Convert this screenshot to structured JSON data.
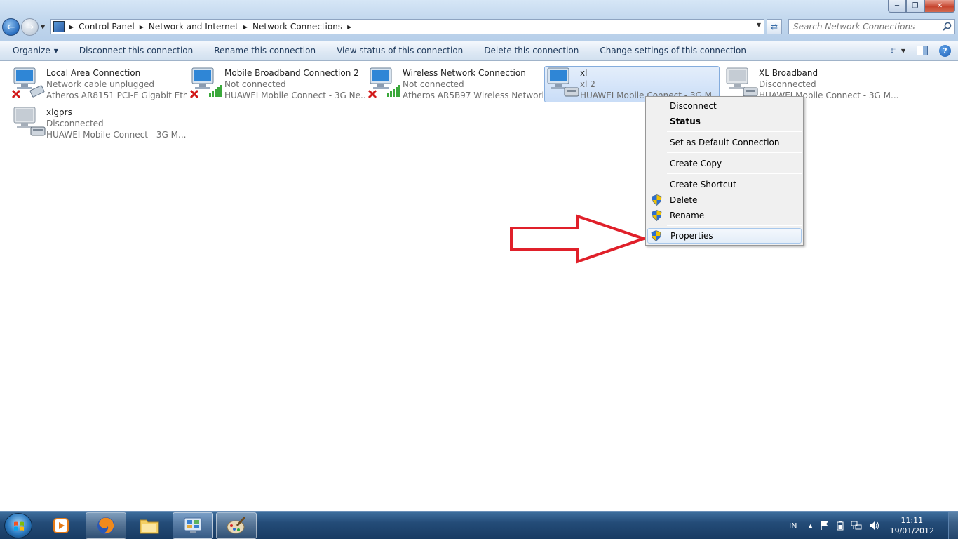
{
  "address": {
    "crumbs": [
      "Control Panel",
      "Network and Internet",
      "Network Connections"
    ]
  },
  "search": {
    "placeholder": "Search Network Connections"
  },
  "toolbar": {
    "organize": "Organize",
    "disconnect": "Disconnect this connection",
    "rename": "Rename this connection",
    "view_status": "View status of this connection",
    "delete": "Delete this connection",
    "change_settings": "Change settings of this connection"
  },
  "connections": [
    {
      "name": "Local Area Connection",
      "status": "Network cable unplugged",
      "device": "Atheros AR8151 PCI-E Gigabit Eth..."
    },
    {
      "name": "Mobile Broadband Connection 2",
      "status": "Not connected",
      "device": "HUAWEI Mobile Connect - 3G Ne..."
    },
    {
      "name": "Wireless Network Connection",
      "status": "Not connected",
      "device": "Atheros AR5B97 Wireless Network..."
    },
    {
      "name": "xl",
      "status": "xl  2",
      "device": "HUAWEI Mobile Connect - 3G M..."
    },
    {
      "name": "XL Broadband",
      "status": "Disconnected",
      "device": "HUAWEI Mobile Connect - 3G M..."
    },
    {
      "name": "xlgprs",
      "status": "Disconnected",
      "device": "HUAWEI Mobile Connect - 3G M..."
    }
  ],
  "context_menu": {
    "disconnect": "Disconnect",
    "status": "Status",
    "set_default": "Set as Default Connection",
    "create_copy": "Create Copy",
    "create_shortcut": "Create Shortcut",
    "delete": "Delete",
    "rename": "Rename",
    "properties": "Properties"
  },
  "tray": {
    "language": "IN",
    "time": "11:11",
    "date": "19/01/2012"
  },
  "colors": {
    "accent_blue": "#1e395b",
    "arrow_red": "#e0202a",
    "selection_border": "#84acdd"
  }
}
